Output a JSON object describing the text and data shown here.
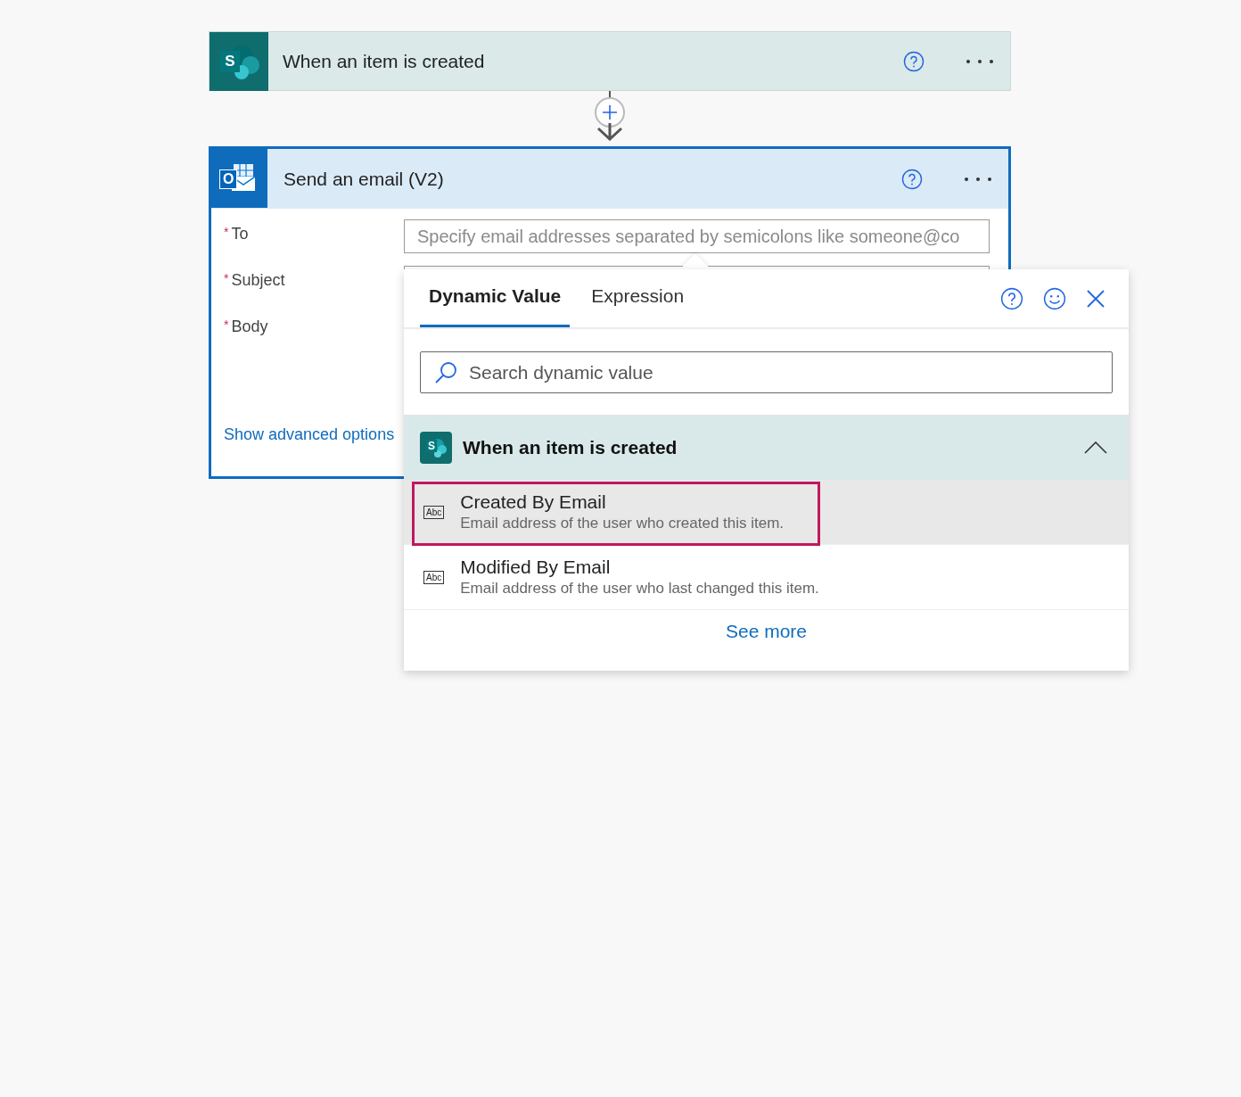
{
  "trigger_card": {
    "logo_letter": "S",
    "title": "When an item is created"
  },
  "action_card": {
    "logo_letter": "O",
    "title": "Send an email (V2)",
    "fields": [
      {
        "required_mark": "*",
        "label": "To",
        "placeholder": "Specify email addresses separated by semicolons like someone@co"
      },
      {
        "required_mark": "*",
        "label": "Subject"
      },
      {
        "required_mark": "*",
        "label": "Body"
      }
    ],
    "advanced_link": "Show advanced options"
  },
  "popup": {
    "tabs": [
      {
        "label": "Dynamic Value",
        "selected": true
      },
      {
        "label": "Expression",
        "selected": false
      }
    ],
    "search": {
      "placeholder": "Search dynamic value"
    },
    "section": {
      "logo_letter": "S",
      "title": "When an item is created",
      "expanded": true,
      "items": [
        {
          "type_label": "Abc",
          "title": "Created By Email",
          "description": "Email address of the user who created this item.",
          "selected": true
        },
        {
          "type_label": "Abc",
          "title": "Modified By Email",
          "description": "Email address of the user who last changed this item.",
          "selected": false
        }
      ]
    },
    "see_more": "See more"
  }
}
